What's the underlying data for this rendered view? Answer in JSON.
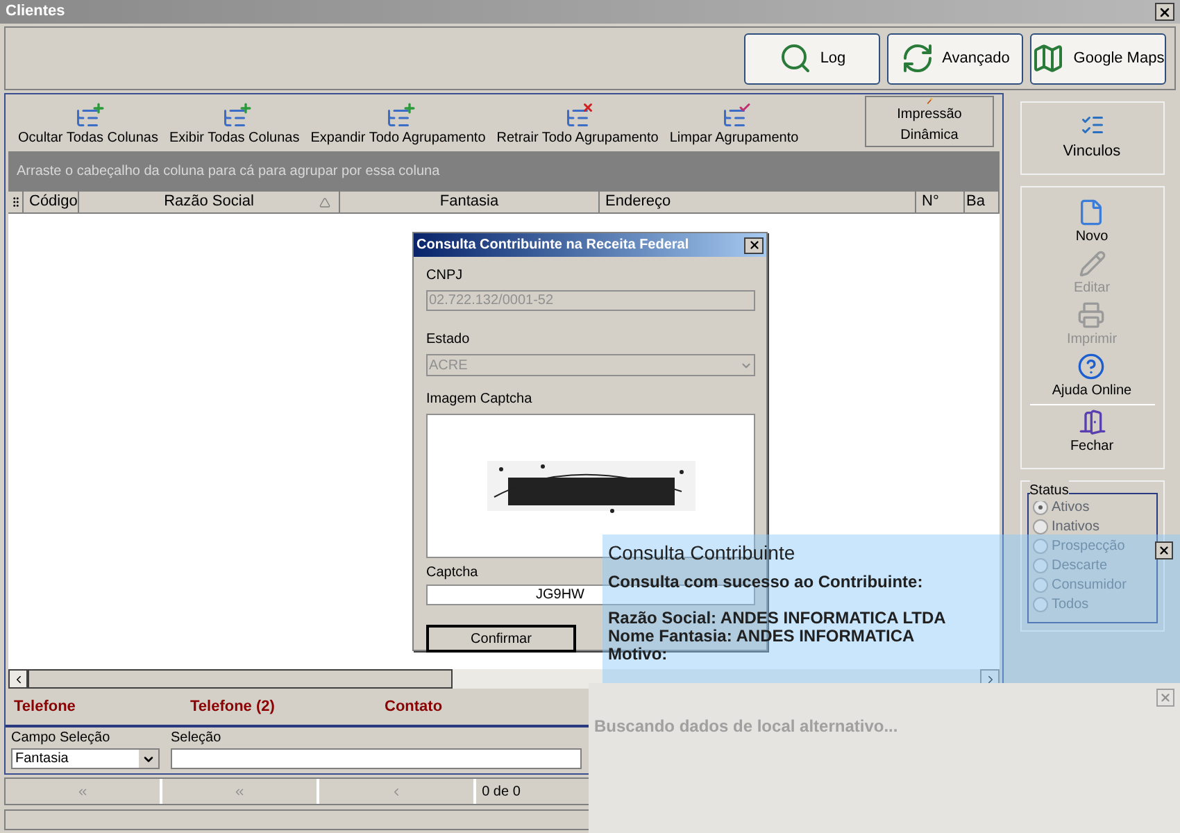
{
  "window": {
    "title": "Clientes"
  },
  "top_buttons": [
    {
      "label": "Log",
      "kind": "log"
    },
    {
      "label": "Avançado",
      "kind": "advanced"
    },
    {
      "label": "Google Maps",
      "kind": "map"
    }
  ],
  "toolbar": [
    {
      "label": "Ocultar Todas Colunas",
      "kind": "add"
    },
    {
      "label": "Exibir Todas  Colunas",
      "kind": "add"
    },
    {
      "label": "Expandir Todo Agrupamento",
      "kind": "add"
    },
    {
      "label": "Retrair Todo Agrupamento",
      "kind": "remove"
    },
    {
      "label": "Limpar Agrupamento",
      "kind": "clear"
    }
  ],
  "print_button": {
    "label": "Impressão Dinâmica"
  },
  "group_hint": "Arraste o cabeçalho da coluna para cá para agrupar por essa coluna",
  "columns": [
    {
      "label": "Código",
      "sorted": false
    },
    {
      "label": "Razão Social",
      "sorted": true
    },
    {
      "label": "Fantasia",
      "sorted": false
    },
    {
      "label": "Endereço",
      "sorted": false
    },
    {
      "label": "N°",
      "sorted": false
    },
    {
      "label": "Ba",
      "sorted": false
    }
  ],
  "footer_labels": [
    "Telefone",
    "Telefone (2)",
    "Contato"
  ],
  "field_select": {
    "label": "Campo Seleção",
    "value": "Fantasia"
  },
  "selection": {
    "label": "Seleção"
  },
  "pager": {
    "text": "0 de 0",
    "buttons": [
      {
        "kind": "first"
      },
      {
        "kind": "prev_page"
      },
      {
        "kind": "prev"
      }
    ]
  },
  "vinculos": {
    "label": "Vinculos"
  },
  "side_actions": [
    {
      "label": "Novo",
      "kind": "new",
      "disabled": false
    },
    {
      "label": "Editar",
      "kind": "edit",
      "disabled": true
    },
    {
      "label": "Imprimir",
      "kind": "print",
      "disabled": true
    },
    {
      "label": "Ajuda Online",
      "kind": "help",
      "disabled": false
    },
    {
      "label": "Fechar",
      "kind": "close",
      "disabled": false
    }
  ],
  "status": {
    "title": "Status",
    "disabled": true,
    "options": [
      {
        "label": "Ativos",
        "selected": true
      },
      {
        "label": "Inativos",
        "selected": false
      },
      {
        "label": "Prospecção",
        "selected": false
      },
      {
        "label": "Descarte",
        "selected": false
      },
      {
        "label": "Consumidor",
        "selected": false
      },
      {
        "label": "Todos",
        "selected": false
      }
    ]
  },
  "dialog": {
    "title": "Consulta Contribuinte na Receita Federal",
    "cnpj": {
      "label": "CNPJ",
      "value": "02.722.132/0001-52",
      "disabled": true
    },
    "estado": {
      "label": "Estado",
      "value": "ACRE",
      "disabled": true
    },
    "image_label": "Imagem Captcha",
    "captcha": {
      "label": "Captcha",
      "value": "JG9HW"
    },
    "buttons": [
      {
        "label": "Confirmar",
        "default": true
      }
    ]
  },
  "notification": {
    "title": "Consulta Contribuinte",
    "message": "Consulta com sucesso ao Contribuinte:",
    "details": [
      "Razão Social: ANDES INFORMATICA LTDA",
      "Nome Fantasia: ANDES INFORMATICA",
      "Motivo:"
    ]
  },
  "alt_toast": {
    "text": "Buscando dados de local alternativo..."
  }
}
